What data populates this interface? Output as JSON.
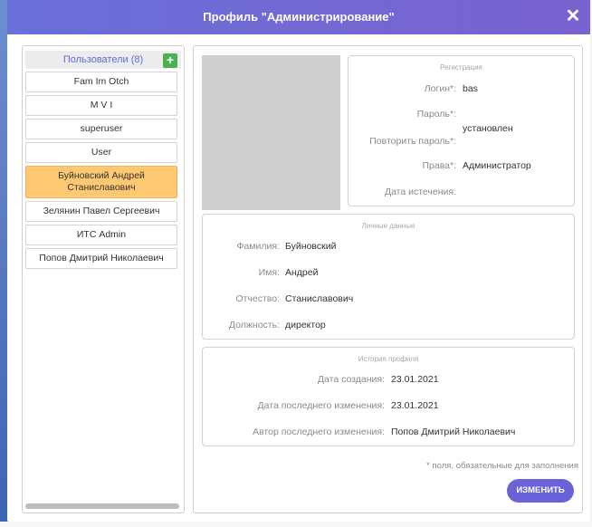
{
  "window": {
    "title": "Профиль \"Администрирование\"",
    "close_glyph": "✕"
  },
  "users": {
    "header": "Пользователи (8)",
    "add_glyph": "+",
    "items": [
      {
        "name": "Fam Im Otch",
        "selected": false
      },
      {
        "name": "M V I",
        "selected": false
      },
      {
        "name": "superuser",
        "selected": false
      },
      {
        "name": "User",
        "selected": false
      },
      {
        "name": "Буйновский Андрей Станиславович",
        "selected": true
      },
      {
        "name": "Зелянин Павел Сергеевич",
        "selected": false
      },
      {
        "name": "ИТС Admin",
        "selected": false
      },
      {
        "name": "Попов Дмитрий Николаевич",
        "selected": false
      }
    ]
  },
  "registration": {
    "title": "Регистрация",
    "login_label": "Логин*:",
    "login_value": "bas",
    "password_label": "Пароль*:",
    "password_status": "установлен",
    "repeat_label": "Повторить пароль*:",
    "rights_label": "Права*:",
    "rights_value": "Администратор",
    "expiry_label": "Дата истечения:",
    "expiry_value": ""
  },
  "personal": {
    "title": "Личные данные",
    "surname_label": "Фамилия:",
    "surname_value": "Буйновский",
    "name_label": "Имя:",
    "name_value": "Андрей",
    "patronymic_label": "Отчество:",
    "patronymic_value": "Станиславович",
    "position_label": "Должность:",
    "position_value": "директор"
  },
  "history": {
    "title": "История профиля",
    "created_label": "Дата создания:",
    "created_value": "23.01.2021",
    "modified_label": "Дата последнего изменения:",
    "modified_value": "23.01.2021",
    "author_label": "Автор последнего изменения:",
    "author_value": "Попов Дмитрий Николаевич"
  },
  "footer": {
    "required_note": "* поля, обязательные для заполнения",
    "edit_button": "ИЗМЕНИТЬ"
  },
  "colors": {
    "accent": "#6a62d8",
    "selected_row": "#ffc873",
    "add_button": "#4caf50"
  }
}
